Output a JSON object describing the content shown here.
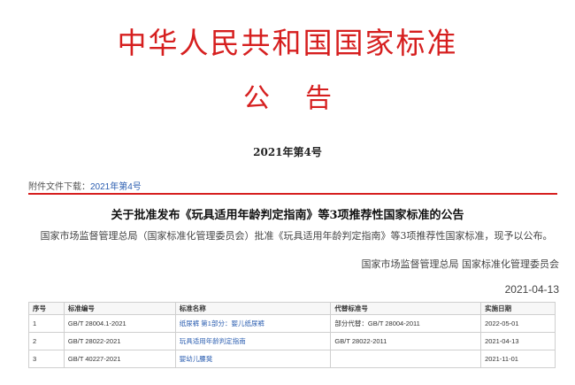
{
  "header": {
    "title": "中华人民共和国国家标准",
    "notice": "公告",
    "issue": "2021年第4号"
  },
  "attachment": {
    "label": "附件文件下载：",
    "link": "2021年第4号"
  },
  "announcement": {
    "headline": "关于批准发布《玩具适用年龄判定指南》等3项推荐性国家标准的公告",
    "body": "国家市场监督管理总局（国家标准化管理委员会）批准《玩具适用年龄判定指南》等3项推荐性国家标准，现予以公布。",
    "signature": "国家市场监督管理总局 国家标准化管理委员会",
    "date": "2021-04-13"
  },
  "table": {
    "headers": [
      "序号",
      "标准编号",
      "标准名称",
      "代替标准号",
      "实施日期"
    ],
    "rows": [
      [
        "1",
        "GB/T 28004.1-2021",
        "纸尿裤 第1部分：婴儿纸尿裤",
        "部分代替：GB/T 28004-2011",
        "2022-05-01"
      ],
      [
        "2",
        "GB/T 28022-2021",
        "玩具适用年龄判定指南",
        "GB/T 28022-2011",
        "2021-04-13"
      ],
      [
        "3",
        "GB/T 40227-2021",
        "婴幼儿腰凳",
        "",
        "2021-11-01"
      ]
    ]
  },
  "colors": {
    "accent_red": "#d61f1f",
    "link_blue": "#2a5db0"
  }
}
